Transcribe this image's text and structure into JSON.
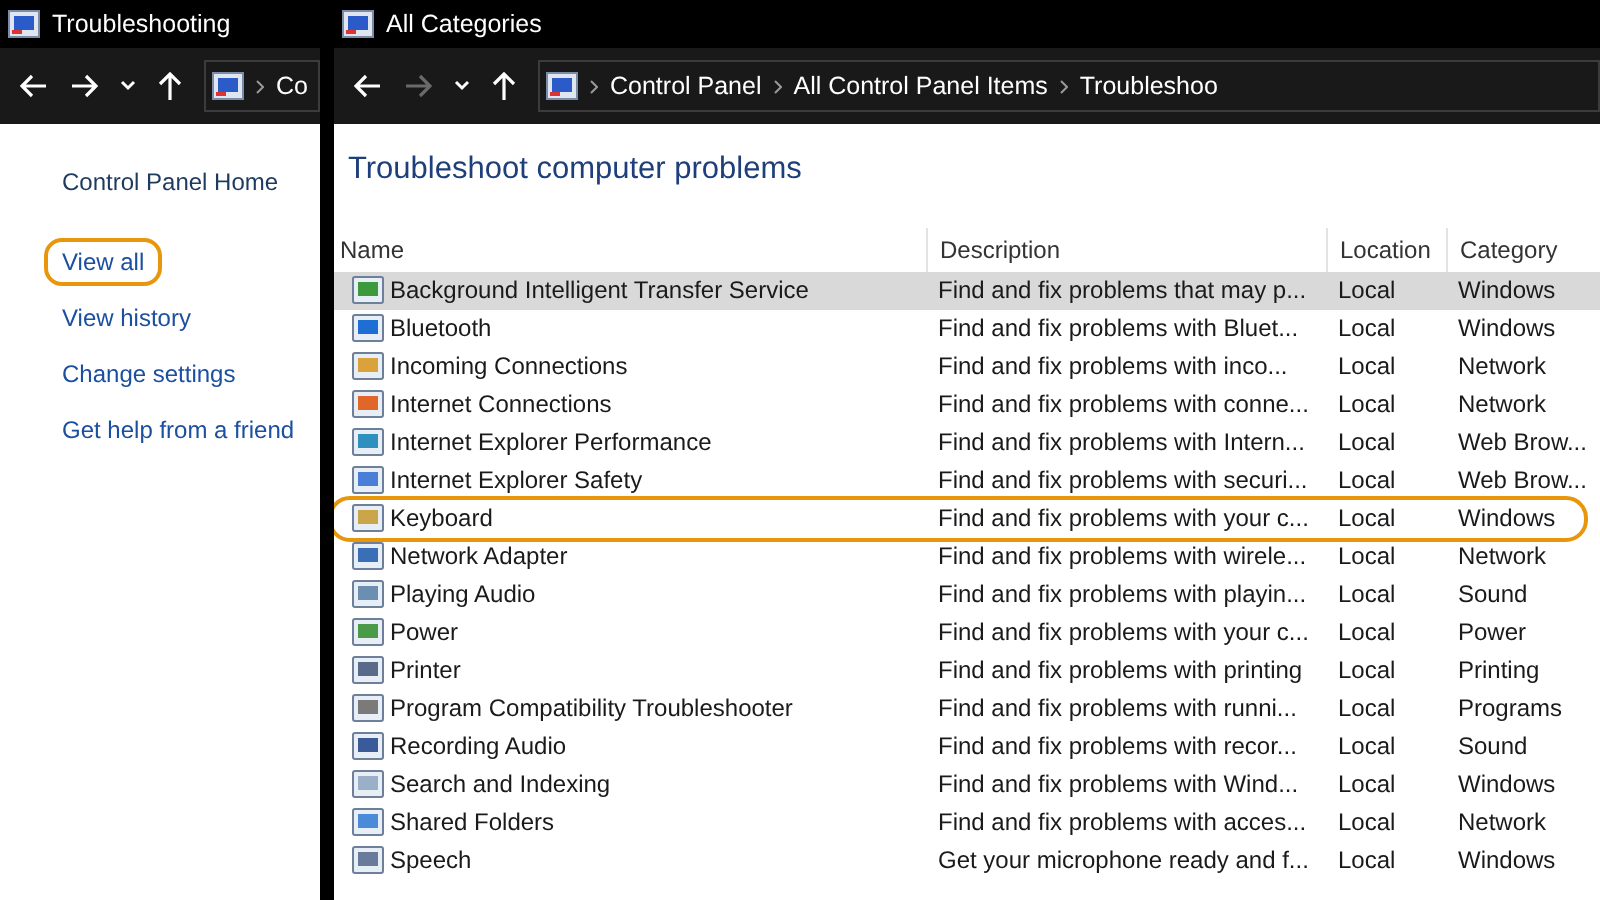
{
  "windows": [
    {
      "title": "Troubleshooting",
      "nav": {
        "back_disabled": false,
        "forward_disabled": false,
        "breadcrumb": [
          "Co"
        ]
      },
      "sidebar": {
        "items": [
          {
            "label": "Control Panel Home",
            "kind": "home",
            "highlighted": false
          },
          {
            "label": "View all",
            "kind": "link",
            "highlighted": true
          },
          {
            "label": "View history",
            "kind": "link",
            "highlighted": false
          },
          {
            "label": "Change settings",
            "kind": "link",
            "highlighted": false
          },
          {
            "label": "Get help from a friend",
            "kind": "link",
            "highlighted": false
          }
        ]
      }
    },
    {
      "title": "All Categories",
      "nav": {
        "back_disabled": false,
        "forward_disabled": true,
        "breadcrumb": [
          "Control Panel",
          "All Control Panel Items",
          "Troubleshoo"
        ]
      },
      "heading": "Troubleshoot computer problems",
      "table": {
        "columns": [
          "Name",
          "Description",
          "Location",
          "Category"
        ],
        "rows": [
          {
            "cells": [
              "Background Intelligent Transfer Service",
              "Find and fix problems that may p...",
              "Local",
              "Windows"
            ],
            "selected": true,
            "highlighted": false
          },
          {
            "cells": [
              "Bluetooth",
              "Find and fix problems with Bluet...",
              "Local",
              "Windows"
            ],
            "selected": false,
            "highlighted": false
          },
          {
            "cells": [
              "Incoming Connections",
              "Find and fix problems with inco...",
              "Local",
              "Network"
            ],
            "selected": false,
            "highlighted": false
          },
          {
            "cells": [
              "Internet Connections",
              "Find and fix problems with conne...",
              "Local",
              "Network"
            ],
            "selected": false,
            "highlighted": false
          },
          {
            "cells": [
              "Internet Explorer Performance",
              "Find and fix problems with Intern...",
              "Local",
              "Web Brow..."
            ],
            "selected": false,
            "highlighted": false
          },
          {
            "cells": [
              "Internet Explorer Safety",
              "Find and fix problems with securi...",
              "Local",
              "Web Brow..."
            ],
            "selected": false,
            "highlighted": false
          },
          {
            "cells": [
              "Keyboard",
              "Find and fix problems with your c...",
              "Local",
              "Windows"
            ],
            "selected": false,
            "highlighted": true
          },
          {
            "cells": [
              "Network Adapter",
              "Find and fix problems with wirele...",
              "Local",
              "Network"
            ],
            "selected": false,
            "highlighted": false
          },
          {
            "cells": [
              "Playing Audio",
              "Find and fix problems with playin...",
              "Local",
              "Sound"
            ],
            "selected": false,
            "highlighted": false
          },
          {
            "cells": [
              "Power",
              "Find and fix problems with your c...",
              "Local",
              "Power"
            ],
            "selected": false,
            "highlighted": false
          },
          {
            "cells": [
              "Printer",
              "Find and fix problems with printing",
              "Local",
              "Printing"
            ],
            "selected": false,
            "highlighted": false
          },
          {
            "cells": [
              "Program Compatibility Troubleshooter",
              "Find and fix problems with runni...",
              "Local",
              "Programs"
            ],
            "selected": false,
            "highlighted": false
          },
          {
            "cells": [
              "Recording Audio",
              "Find and fix problems with recor...",
              "Local",
              "Sound"
            ],
            "selected": false,
            "highlighted": false
          },
          {
            "cells": [
              "Search and Indexing",
              "Find and fix problems with Wind...",
              "Local",
              "Windows"
            ],
            "selected": false,
            "highlighted": false
          },
          {
            "cells": [
              "Shared Folders",
              "Find and fix problems with acces...",
              "Local",
              "Network"
            ],
            "selected": false,
            "highlighted": false
          },
          {
            "cells": [
              "Speech",
              "Get your microphone ready and f...",
              "Local",
              "Windows"
            ],
            "selected": false,
            "highlighted": false
          }
        ]
      }
    }
  ]
}
